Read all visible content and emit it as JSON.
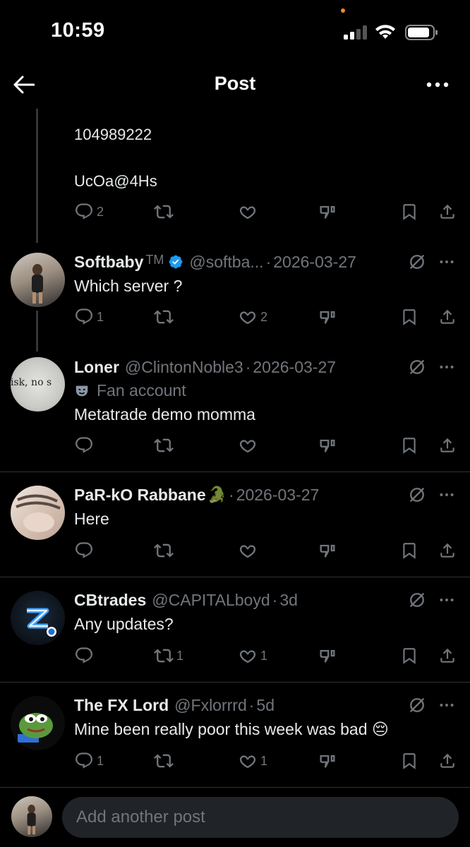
{
  "status_bar": {
    "time": "10:59"
  },
  "header": {
    "title": "Post",
    "back_icon": "back-arrow-icon",
    "more_icon": "more-horizontal-icon"
  },
  "parent_post": {
    "text_line1": "104989222",
    "text_line2": "UcOa@4Hs",
    "reply_count": "2"
  },
  "posts": [
    {
      "name": "Softbaby",
      "trademark": "TM",
      "verified": true,
      "handle": "@softba...",
      "date": "2026-03-27",
      "text": "Which server ?",
      "reply_count": "1",
      "retweet_count": "",
      "like_count": "2"
    },
    {
      "name": "Loner",
      "handle": "@ClintonNoble3",
      "date": "2026-03-27",
      "label": "Fan account",
      "text": "Metatrade demo momma",
      "avatar_text": "isk, no s",
      "reply_count": "",
      "retweet_count": "",
      "like_count": ""
    },
    {
      "name": "PaR-kO Rabbane",
      "name_emoji": "🐊",
      "date": "2026-03-27",
      "text": "Here",
      "reply_count": "",
      "retweet_count": "",
      "like_count": ""
    },
    {
      "name": "CBtrades",
      "handle": "@CAPITALboyd",
      "date": "3d",
      "text": "Any updates?",
      "reply_count": "",
      "retweet_count": "1",
      "like_count": "1"
    },
    {
      "name": "The FX Lord",
      "handle": "@Fxlorrrd",
      "date": "5d",
      "text": "Mine been really poor this week was bad 😔",
      "reply_count": "1",
      "retweet_count": "",
      "like_count": "1"
    }
  ],
  "composer": {
    "placeholder": "Add another post"
  },
  "colors": {
    "background": "#000000",
    "text": "#e7e9ea",
    "muted": "#71767b",
    "verified": "#1d9bf0",
    "divider": "#2f3336"
  }
}
